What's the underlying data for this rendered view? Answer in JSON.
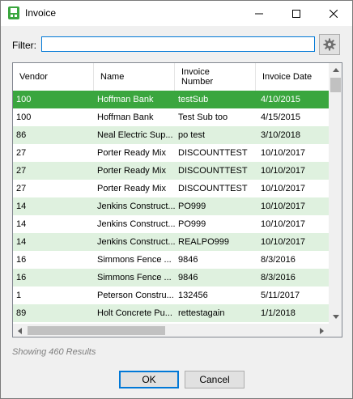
{
  "window": {
    "title": "Invoice",
    "app_icon": "sage-app-icon",
    "controls": {
      "minimize": "minimize-icon",
      "maximize": "maximize-icon",
      "close": "close-icon"
    }
  },
  "filter": {
    "label": "Filter:",
    "value": "",
    "settings_icon": "gear-icon"
  },
  "grid": {
    "columns": [
      "Vendor",
      "Name",
      "Invoice Number",
      "Invoice Date"
    ],
    "rows": [
      {
        "vendor": "100",
        "name": "Hoffman Bank",
        "invoice_number": "testSub",
        "invoice_date": "4/10/2015",
        "selected": true
      },
      {
        "vendor": "100",
        "name": "Hoffman Bank",
        "invoice_number": "Test Sub too",
        "invoice_date": "4/15/2015"
      },
      {
        "vendor": "86",
        "name": "Neal Electric Sup...",
        "invoice_number": "po test",
        "invoice_date": "3/10/2018"
      },
      {
        "vendor": "27",
        "name": "Porter Ready Mix",
        "invoice_number": "DISCOUNTTEST",
        "invoice_date": "10/10/2017"
      },
      {
        "vendor": "27",
        "name": "Porter Ready Mix",
        "invoice_number": "DISCOUNTTEST",
        "invoice_date": "10/10/2017"
      },
      {
        "vendor": "27",
        "name": "Porter Ready Mix",
        "invoice_number": "DISCOUNTTEST",
        "invoice_date": "10/10/2017"
      },
      {
        "vendor": "14",
        "name": "Jenkins Construct...",
        "invoice_number": "PO999",
        "invoice_date": "10/10/2017"
      },
      {
        "vendor": "14",
        "name": "Jenkins Construct...",
        "invoice_number": "PO999",
        "invoice_date": "10/10/2017"
      },
      {
        "vendor": "14",
        "name": "Jenkins Construct...",
        "invoice_number": "REALPO999",
        "invoice_date": "10/10/2017"
      },
      {
        "vendor": "16",
        "name": "Simmons Fence ...",
        "invoice_number": "9846",
        "invoice_date": "8/3/2016"
      },
      {
        "vendor": "16",
        "name": "Simmons Fence ...",
        "invoice_number": "9846",
        "invoice_date": "8/3/2016"
      },
      {
        "vendor": "1",
        "name": "Peterson Constru...",
        "invoice_number": "132456",
        "invoice_date": "5/11/2017"
      },
      {
        "vendor": "89",
        "name": "Holt Concrete Pu...",
        "invoice_number": "rettestagain",
        "invoice_date": "1/1/2018"
      }
    ],
    "row_colors": {
      "selected": "#3aa63e",
      "alternate": "#dff1df",
      "normal": "#ffffff"
    }
  },
  "status": {
    "text": "Showing 460 Results"
  },
  "buttons": {
    "ok": "OK",
    "cancel": "Cancel"
  }
}
